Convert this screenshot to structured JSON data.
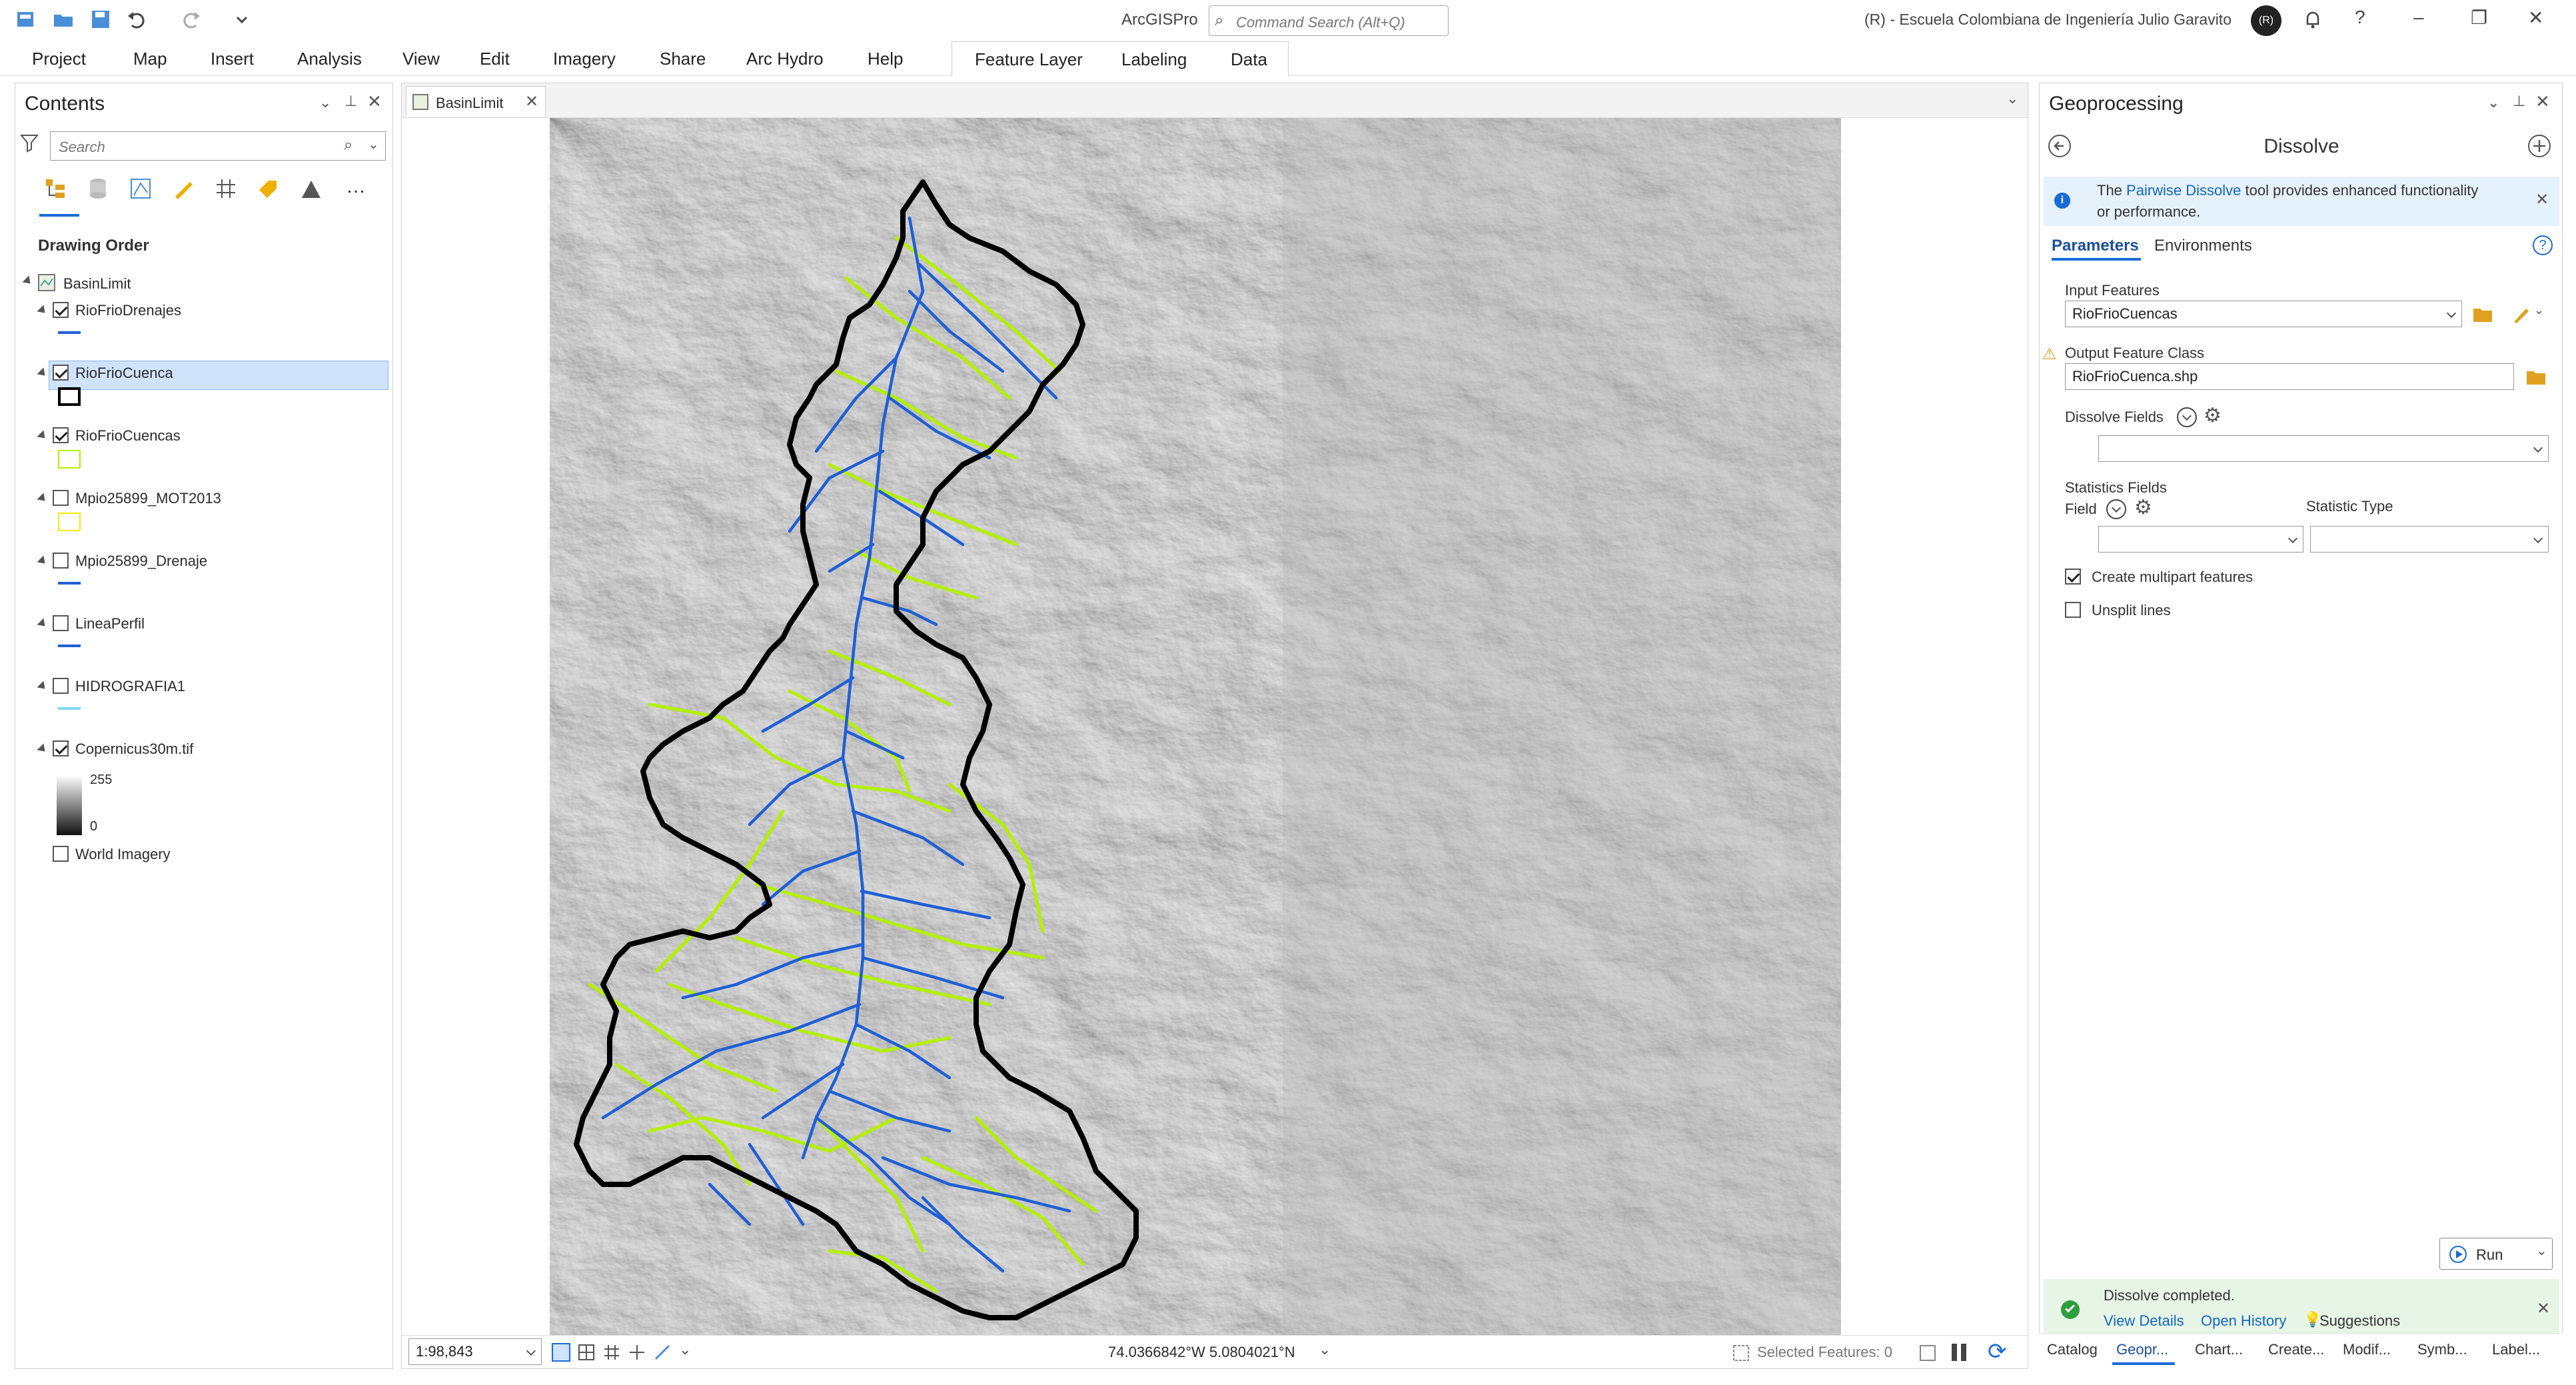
{
  "app": {
    "title": "ArcGISPro",
    "command_search_placeholder": "Command Search (Alt+Q)",
    "org": "(R) - Escuela Colombiana de Ingeniería Julio Garavito",
    "avatar_initials": "(R)"
  },
  "ribbon": {
    "tabs": [
      "Project",
      "Map",
      "Insert",
      "Analysis",
      "View",
      "Edit",
      "Imagery",
      "Share",
      "Arc Hydro",
      "Help"
    ],
    "contextual_tabs": [
      "Feature Layer",
      "Labeling",
      "Data"
    ]
  },
  "contents": {
    "title": "Contents",
    "search_placeholder": "Search",
    "section": "Drawing Order",
    "map_name": "BasinLimit",
    "layers": [
      {
        "name": "RioFrioDrenajes",
        "checked": true,
        "symbol": "line",
        "color": "#1f5fd6"
      },
      {
        "name": "RioFrioCuenca",
        "checked": true,
        "symbol": "polygon",
        "color": "#000000",
        "selected": true
      },
      {
        "name": "RioFrioCuencas",
        "checked": true,
        "symbol": "polygon",
        "color": "#b4f000"
      },
      {
        "name": "Mpio25899_MOT2013",
        "checked": false,
        "symbol": "polygon",
        "color": "#f0f000"
      },
      {
        "name": "Mpio25899_Drenaje",
        "checked": false,
        "symbol": "line",
        "color": "#1f5fd6"
      },
      {
        "name": "LineaPerfil",
        "checked": false,
        "symbol": "line",
        "color": "#1f5fd6"
      },
      {
        "name": "HIDROGRAFIA1",
        "checked": false,
        "symbol": "line",
        "color": "#7fd8f5"
      },
      {
        "name": "Copernicus30m.tif",
        "checked": true,
        "symbol": "ramp"
      }
    ],
    "ramp_high": "255",
    "ramp_low": "0",
    "basemap": "World Imagery"
  },
  "map": {
    "tab_label": "BasinLimit",
    "scale": "1:98,843",
    "coordinates": "74.0366842°W 5.0804021°N",
    "selected_features": "Selected Features: 0"
  },
  "geoprocessing": {
    "title": "Geoprocessing",
    "tool": "Dissolve",
    "info_pre": "The ",
    "info_link": "Pairwise Dissolve",
    "info_post": " tool provides enhanced functionality",
    "info_line2": "or performance.",
    "tabs": [
      "Parameters",
      "Environments"
    ],
    "input_label": "Input Features",
    "input_value": "RioFrioCuencas",
    "output_label": "Output Feature Class",
    "output_value": "RioFrioCuenca.shp",
    "dissolve_fields_label": "Dissolve Fields",
    "statistics_label": "Statistics Fields",
    "field_label": "Field",
    "statistic_type_label": "Statistic Type",
    "create_multipart": "Create multipart features",
    "unsplit_lines": "Unsplit lines",
    "run": "Run",
    "status": "Dissolve completed.",
    "view_details": "View Details",
    "open_history": "Open History",
    "suggestions": "Suggestions"
  },
  "bottom_tabs": [
    "Catalog",
    "Geopr...",
    "Chart...",
    "Create...",
    "Modif...",
    "Symb...",
    "Label..."
  ]
}
